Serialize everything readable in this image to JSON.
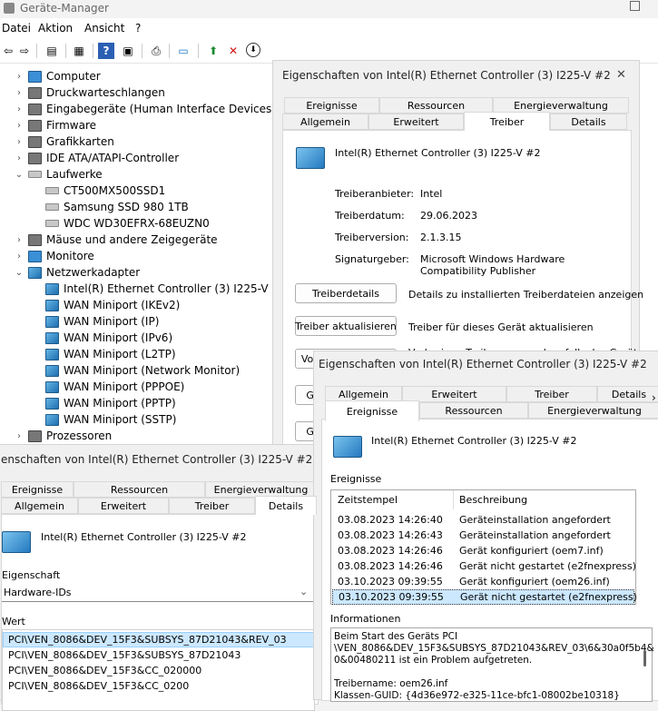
{
  "app": {
    "title": "Geräte-Manager",
    "menu": [
      "Datei",
      "Aktion",
      "Ansicht",
      "?"
    ]
  },
  "tree": [
    {
      "label": "Computer",
      "level": 0,
      "expander": "›",
      "icon": "monitor-icon"
    },
    {
      "label": "Druckwarteschlangen",
      "level": 0,
      "expander": "›",
      "icon": "printer-icon"
    },
    {
      "label": "Eingabegeräte (Human Interface Devices)",
      "level": 0,
      "expander": "›",
      "icon": "hid-icon"
    },
    {
      "label": "Firmware",
      "level": 0,
      "expander": "›",
      "icon": "chip-icon"
    },
    {
      "label": "Grafikkarten",
      "level": 0,
      "expander": "›",
      "icon": "display-adapter-icon"
    },
    {
      "label": "IDE ATA/ATAPI-Controller",
      "level": 0,
      "expander": "›",
      "icon": "ide-icon"
    },
    {
      "label": "Laufwerke",
      "level": 0,
      "expander": "⌄",
      "icon": "disk-icon"
    },
    {
      "label": "CT500MX500SSD1",
      "level": 1,
      "expander": "",
      "icon": "disk-icon"
    },
    {
      "label": "Samsung SSD 980 1TB",
      "level": 1,
      "expander": "",
      "icon": "disk-icon"
    },
    {
      "label": "WDC WD30EFRX-68EUZN0",
      "level": 1,
      "expander": "",
      "icon": "disk-icon"
    },
    {
      "label": "Mäuse und andere Zeigegeräte",
      "level": 0,
      "expander": "›",
      "icon": "mouse-icon"
    },
    {
      "label": "Monitore",
      "level": 0,
      "expander": "›",
      "icon": "monitor-icon"
    },
    {
      "label": "Netzwerkadapter",
      "level": 0,
      "expander": "⌄",
      "icon": "network-icon"
    },
    {
      "label": "Intel(R) Ethernet Controller (3) I225-V #2",
      "level": 1,
      "expander": "",
      "icon": "network-icon"
    },
    {
      "label": "WAN Miniport (IKEv2)",
      "level": 1,
      "expander": "",
      "icon": "network-icon"
    },
    {
      "label": "WAN Miniport (IP)",
      "level": 1,
      "expander": "",
      "icon": "network-icon"
    },
    {
      "label": "WAN Miniport (IPv6)",
      "level": 1,
      "expander": "",
      "icon": "network-icon"
    },
    {
      "label": "WAN Miniport (L2TP)",
      "level": 1,
      "expander": "",
      "icon": "network-icon"
    },
    {
      "label": "WAN Miniport (Network Monitor)",
      "level": 1,
      "expander": "",
      "icon": "network-icon"
    },
    {
      "label": "WAN Miniport (PPPOE)",
      "level": 1,
      "expander": "",
      "icon": "network-icon"
    },
    {
      "label": "WAN Miniport (PPTP)",
      "level": 1,
      "expander": "",
      "icon": "network-icon"
    },
    {
      "label": "WAN Miniport (SSTP)",
      "level": 1,
      "expander": "",
      "icon": "network-icon"
    },
    {
      "label": "Prozessoren",
      "level": 0,
      "expander": "›",
      "icon": "cpu-icon"
    }
  ],
  "dlgDriver": {
    "title": "Eigenschaften von Intel(R) Ethernet Controller (3) I225-V #2",
    "close": "✕",
    "tabsTop": [
      "Ereignisse",
      "Ressourcen",
      "Energieverwaltung"
    ],
    "tabsBottom": [
      "Allgemein",
      "Erweitert",
      "Treiber",
      "Details"
    ],
    "device": "Intel(R) Ethernet Controller (3) I225-V #2",
    "fields": [
      {
        "k": "Treiberanbieter:",
        "v": "Intel"
      },
      {
        "k": "Treiberdatum:",
        "v": "29.06.2023"
      },
      {
        "k": "Treiberversion:",
        "v": "2.1.3.15"
      },
      {
        "k": "Signaturgeber:",
        "v": "Microsoft Windows Hardware Compatibility Publisher"
      }
    ],
    "buttons": [
      {
        "label": "Treiberdetails",
        "desc": "Details zu installierten Treiberdateien anzeigen"
      },
      {
        "label": "Treiber aktualisieren",
        "desc": "Treiber für dieses Gerät aktualisieren"
      },
      {
        "label": "Vorheriger Treiber",
        "desc": "Vorherigen Treiber verwenden, falls das Gerät"
      },
      {
        "label": "Ge",
        "desc": ""
      },
      {
        "label": "Ge",
        "desc": ""
      }
    ]
  },
  "dlgDetails": {
    "title": "enschaften von Intel(R) Ethernet Controller (3) I225-V #2",
    "tabsTop": [
      "Ereignisse",
      "Ressourcen",
      "Energieverwaltung"
    ],
    "tabsBottom": [
      "Allgemein",
      "Erweitert",
      "Treiber",
      "Details"
    ],
    "device": "Intel(R) Ethernet Controller (3) I225-V #2",
    "propLabel": "Eigenschaft",
    "propValue": "Hardware-IDs",
    "valueLabel": "Wert",
    "values": [
      "PCI\\VEN_8086&DEV_15F3&SUBSYS_87D21043&REV_03",
      "PCI\\VEN_8086&DEV_15F3&SUBSYS_87D21043",
      "PCI\\VEN_8086&DEV_15F3&CC_020000",
      "PCI\\VEN_8086&DEV_15F3&CC_0200"
    ]
  },
  "dlgEvents": {
    "title": "Eigenschaften von Intel(R) Ethernet Controller (3) I225-V #2",
    "close": "✕",
    "tabsTop": [
      "Allgemein",
      "Erweitert",
      "Treiber",
      "Details"
    ],
    "tabsBottom": [
      "Ereignisse",
      "Ressourcen",
      "Energieverwaltung"
    ],
    "device": "Intel(R) Ethernet Controller (3) I225-V #2",
    "eventsLabel": "Ereignisse",
    "colTime": "Zeitstempel",
    "colDesc": "Beschreibung",
    "rows": [
      {
        "t": "03.08.2023 14:26:40",
        "d": "Geräteinstallation angefordert"
      },
      {
        "t": "03.08.2023 14:26:43",
        "d": "Geräteinstallation angefordert"
      },
      {
        "t": "03.08.2023 14:26:46",
        "d": "Gerät konfiguriert (oem7.inf)"
      },
      {
        "t": "03.08.2023 14:26:46",
        "d": "Gerät nicht gestartet (e2fnexpress)"
      },
      {
        "t": "03.10.2023 09:39:55",
        "d": "Gerät konfiguriert (oem26.inf)"
      },
      {
        "t": "03.10.2023 09:39:55",
        "d": "Gerät nicht gestartet (e2fnexpress)"
      }
    ],
    "infoLabel": "Informationen",
    "info": [
      "Beim Start des Geräts PCI",
      "\\VEN_8086&DEV_15F3&SUBSYS_87D21043&REV_03\\6&30a0f5b4&",
      "0&00480211 ist ein Problem aufgetreten.",
      "",
      "Treibername: oem26.inf",
      "Klassen-GUID: {4d36e972-e325-11ce-bfc1-08002be10318}"
    ]
  }
}
